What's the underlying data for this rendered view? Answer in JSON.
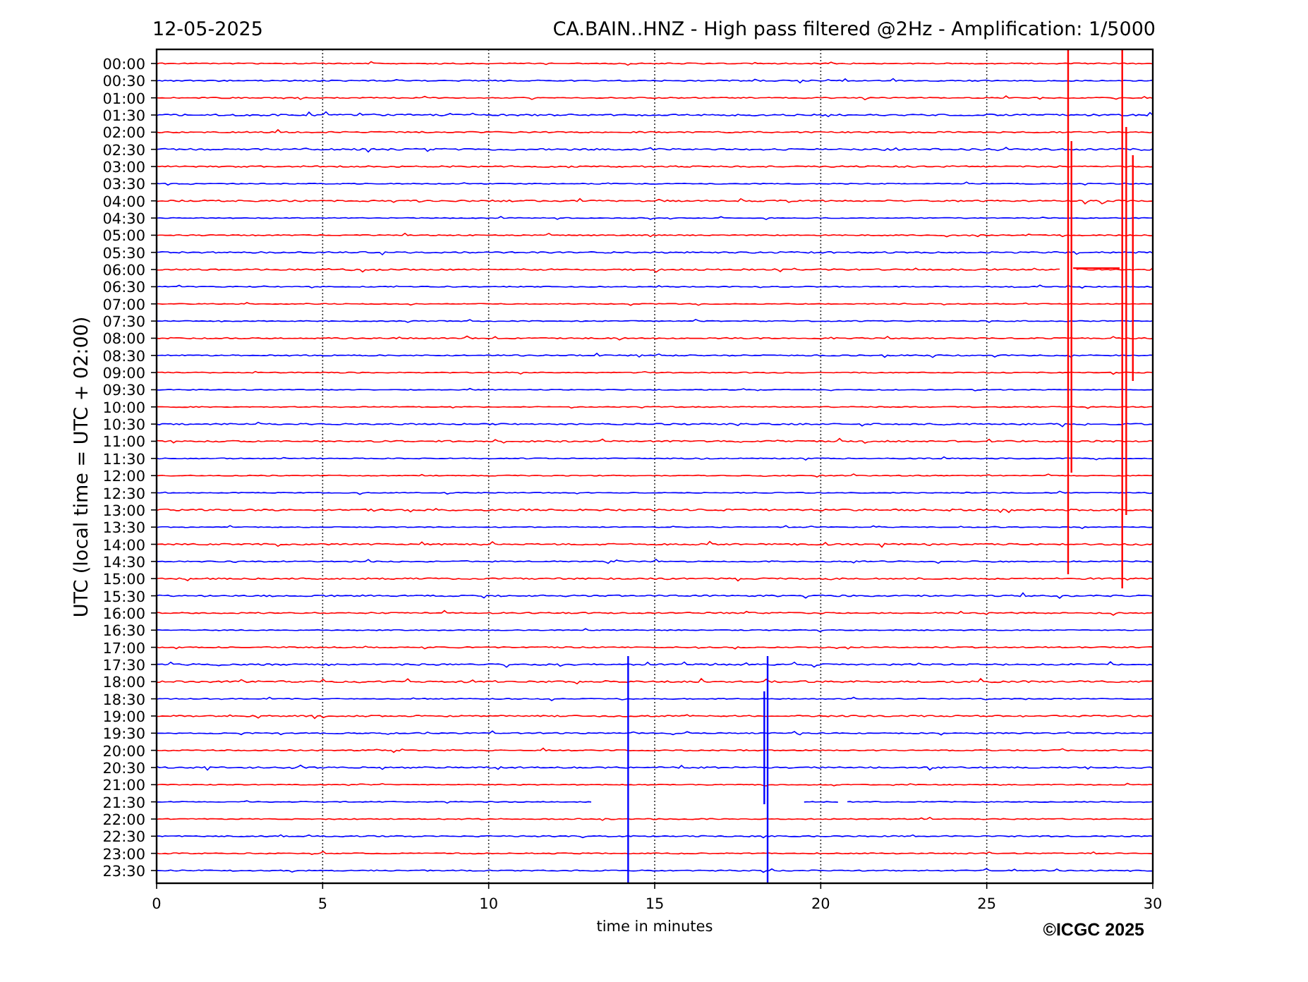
{
  "header": {
    "date": "12-05-2025",
    "title": "CA.BAIN..HNZ - High pass filtered @2Hz - Amplification: 1/5000"
  },
  "plot": {
    "ylabel": "UTC (local time = UTC + 02:00)",
    "xlabel": "time in minutes",
    "rows": [
      {
        "label": "00:00",
        "color": "#ff0000"
      },
      {
        "label": "00:30",
        "color": "#0000ff"
      },
      {
        "label": "01:00",
        "color": "#ff0000"
      },
      {
        "label": "01:30",
        "color": "#0000ff"
      },
      {
        "label": "02:00",
        "color": "#ff0000"
      },
      {
        "label": "02:30",
        "color": "#0000ff"
      },
      {
        "label": "03:00",
        "color": "#ff0000"
      },
      {
        "label": "03:30",
        "color": "#0000ff"
      },
      {
        "label": "04:00",
        "color": "#ff0000"
      },
      {
        "label": "04:30",
        "color": "#0000ff"
      },
      {
        "label": "05:00",
        "color": "#ff0000"
      },
      {
        "label": "05:30",
        "color": "#0000ff"
      },
      {
        "label": "06:00",
        "color": "#ff0000"
      },
      {
        "label": "06:30",
        "color": "#0000ff"
      },
      {
        "label": "07:00",
        "color": "#ff0000"
      },
      {
        "label": "07:30",
        "color": "#0000ff"
      },
      {
        "label": "08:00",
        "color": "#ff0000"
      },
      {
        "label": "08:30",
        "color": "#0000ff"
      },
      {
        "label": "09:00",
        "color": "#ff0000"
      },
      {
        "label": "09:30",
        "color": "#0000ff"
      },
      {
        "label": "10:00",
        "color": "#ff0000"
      },
      {
        "label": "10:30",
        "color": "#0000ff"
      },
      {
        "label": "11:00",
        "color": "#ff0000"
      },
      {
        "label": "11:30",
        "color": "#0000ff"
      },
      {
        "label": "12:00",
        "color": "#ff0000"
      },
      {
        "label": "12:30",
        "color": "#0000ff"
      },
      {
        "label": "13:00",
        "color": "#ff0000"
      },
      {
        "label": "13:30",
        "color": "#0000ff"
      },
      {
        "label": "14:00",
        "color": "#ff0000"
      },
      {
        "label": "14:30",
        "color": "#0000ff"
      },
      {
        "label": "15:00",
        "color": "#ff0000"
      },
      {
        "label": "15:30",
        "color": "#0000ff"
      },
      {
        "label": "16:00",
        "color": "#ff0000"
      },
      {
        "label": "16:30",
        "color": "#0000ff"
      },
      {
        "label": "17:00",
        "color": "#ff0000"
      },
      {
        "label": "17:30",
        "color": "#0000ff"
      },
      {
        "label": "18:00",
        "color": "#ff0000"
      },
      {
        "label": "18:30",
        "color": "#0000ff"
      },
      {
        "label": "19:00",
        "color": "#ff0000"
      },
      {
        "label": "19:30",
        "color": "#0000ff"
      },
      {
        "label": "20:00",
        "color": "#ff0000"
      },
      {
        "label": "20:30",
        "color": "#0000ff"
      },
      {
        "label": "21:00",
        "color": "#ff0000"
      },
      {
        "label": "21:30",
        "color": "#0000ff"
      },
      {
        "label": "22:00",
        "color": "#ff0000"
      },
      {
        "label": "22:30",
        "color": "#0000ff"
      },
      {
        "label": "23:00",
        "color": "#ff0000"
      },
      {
        "label": "23:30",
        "color": "#0000ff"
      }
    ],
    "xticks": [
      "0",
      "5",
      "10",
      "15",
      "20",
      "25",
      "30"
    ]
  },
  "credit": "©ICGC 2025"
}
